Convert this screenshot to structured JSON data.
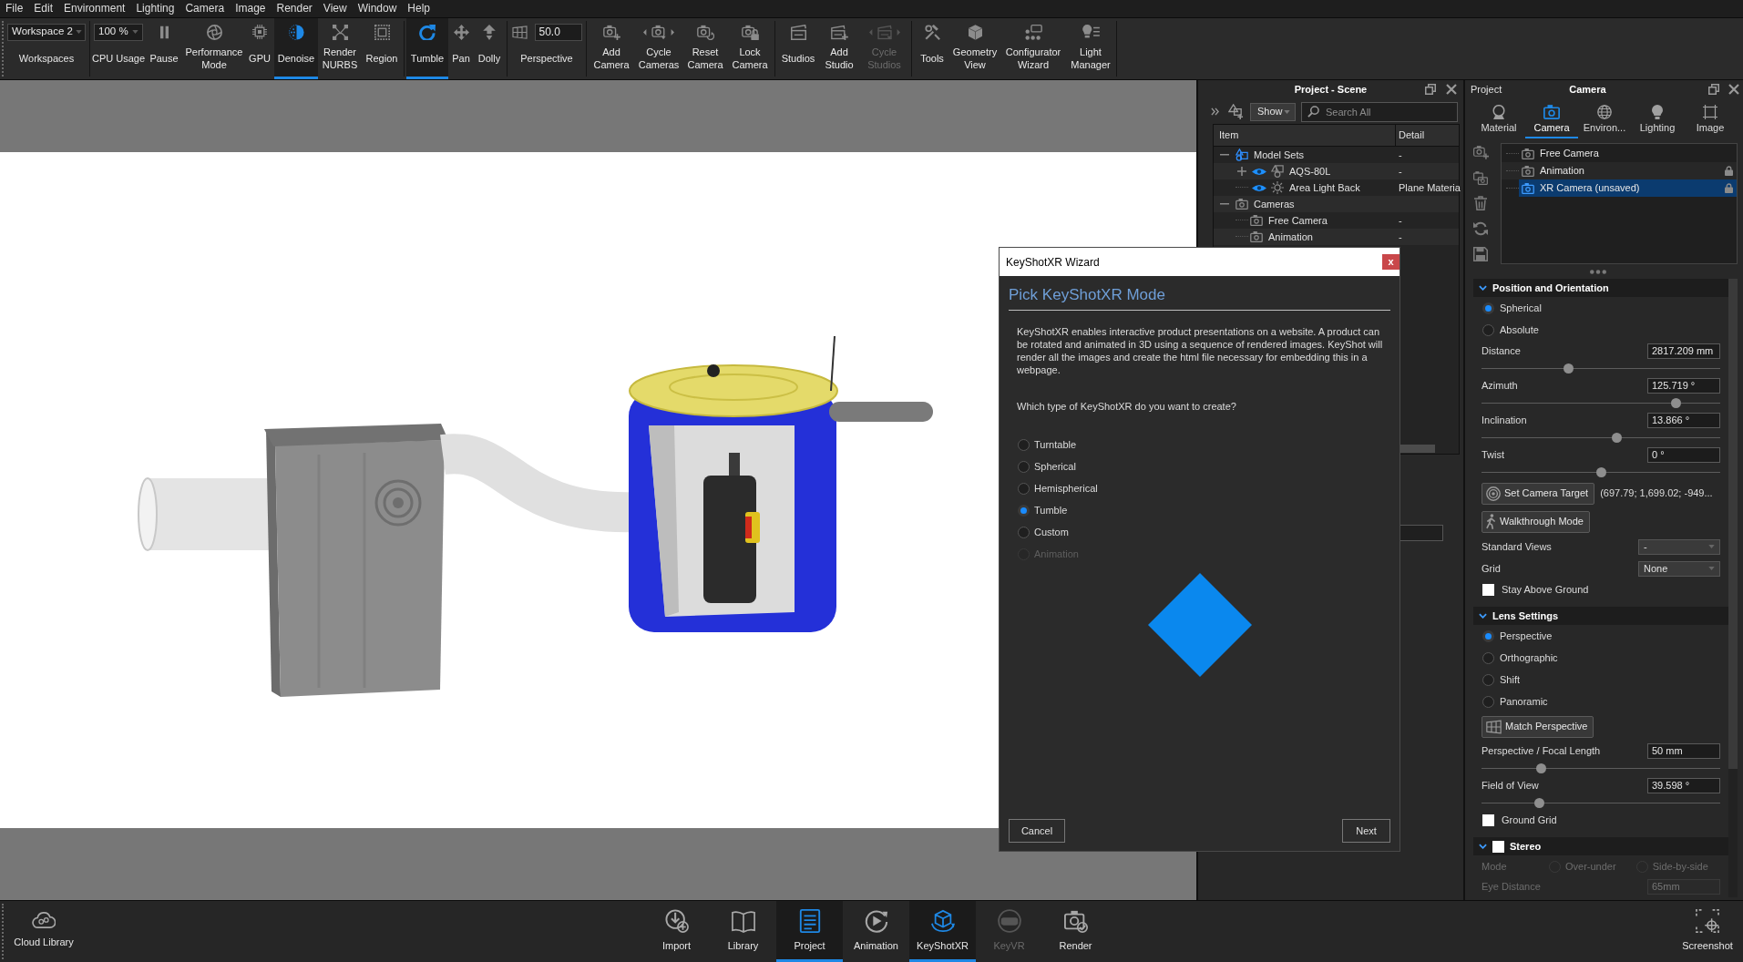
{
  "menu_bar": [
    "File",
    "Edit",
    "Environment",
    "Lighting",
    "Camera",
    "Image",
    "Render",
    "View",
    "Window",
    "Help"
  ],
  "toolbar": [
    {
      "items": [
        {
          "kind": "dropdown",
          "value": "Workspace 2",
          "label": "Workspaces"
        }
      ]
    },
    {
      "items": [
        {
          "kind": "dropdown",
          "value": "100 %",
          "label": "CPU Usage"
        },
        {
          "kind": "button",
          "label": "Pause",
          "selected": false,
          "disabled": false
        },
        {
          "kind": "button",
          "label": "Performance Mode",
          "selected": false,
          "disabled": false
        },
        {
          "kind": "button",
          "label": "GPU",
          "selected": false,
          "disabled": false
        },
        {
          "kind": "button",
          "label": "Denoise",
          "selected": true,
          "disabled": false
        },
        {
          "kind": "button",
          "label": "Render NURBS",
          "selected": false,
          "disabled": false
        },
        {
          "kind": "button",
          "label": "Region",
          "selected": false,
          "disabled": false
        }
      ]
    },
    {
      "items": [
        {
          "kind": "button",
          "label": "Tumble",
          "selected": true,
          "disabled": false
        },
        {
          "kind": "button",
          "label": "Pan",
          "selected": false,
          "disabled": false
        },
        {
          "kind": "button",
          "label": "Dolly",
          "selected": false,
          "disabled": false
        }
      ]
    },
    {
      "items": [
        {
          "kind": "number",
          "value": "50.0",
          "label": "Perspective"
        }
      ]
    },
    {
      "items": [
        {
          "kind": "button",
          "label": "Add Camera",
          "selected": false,
          "disabled": false
        },
        {
          "kind": "button",
          "label": "Cycle Cameras",
          "selected": false,
          "disabled": false
        },
        {
          "kind": "button",
          "label": "Reset Camera",
          "selected": false,
          "disabled": false
        },
        {
          "kind": "button",
          "label": "Lock Camera",
          "selected": false,
          "disabled": false
        }
      ]
    },
    {
      "items": [
        {
          "kind": "button",
          "label": "Studios",
          "selected": false,
          "disabled": false
        },
        {
          "kind": "button",
          "label": "Add Studio",
          "selected": false,
          "disabled": false
        },
        {
          "kind": "button",
          "label": "Cycle Studios",
          "selected": false,
          "disabled": true
        }
      ]
    },
    {
      "items": [
        {
          "kind": "button",
          "label": "Tools",
          "selected": false,
          "disabled": false
        },
        {
          "kind": "button",
          "label": "Geometry View",
          "selected": false,
          "disabled": false
        },
        {
          "kind": "button",
          "label": "Configurator Wizard",
          "selected": false,
          "disabled": false
        },
        {
          "kind": "button",
          "label": "Light Manager",
          "selected": false,
          "disabled": false
        }
      ]
    }
  ],
  "scene_panel": {
    "title": "Project - Scene",
    "show_button": "Show",
    "search": {
      "placeholder": "Search All"
    },
    "columns": [
      "Item",
      "Detail"
    ],
    "rows": [
      {
        "kind": "model_set",
        "label": "Model Sets",
        "detail": "-",
        "expanded": true,
        "children": [
          {
            "kind": "model",
            "label": "AQS-80L",
            "detail": "-",
            "expanded": false,
            "visible": true
          },
          {
            "kind": "light",
            "label": "Area Light Back",
            "detail": "Plane Materia",
            "visible": true
          }
        ]
      },
      {
        "kind": "camera_group",
        "label": "Cameras",
        "expanded": true,
        "children": [
          {
            "kind": "camera",
            "label": "Free Camera",
            "detail": "-"
          },
          {
            "kind": "camera",
            "label": "Animation",
            "detail": "-"
          }
        ]
      }
    ]
  },
  "camera_panel": {
    "project_label": "Project",
    "title": "Camera",
    "tabs": [
      {
        "label": "Material",
        "selected": false
      },
      {
        "label": "Camera",
        "selected": true
      },
      {
        "label": "Environ...",
        "selected": false
      },
      {
        "label": "Lighting",
        "selected": false
      },
      {
        "label": "Image",
        "selected": false
      }
    ],
    "cameras": [
      {
        "label": "Free Camera",
        "selected": false,
        "locked": false
      },
      {
        "label": "Animation",
        "selected": false,
        "locked": true
      },
      {
        "label": "XR Camera (unsaved)",
        "selected": true,
        "locked": true
      }
    ],
    "sections": [
      {
        "title": "Position and Orientation",
        "expanded": true,
        "rows": [
          {
            "kind": "radio",
            "label": "Spherical",
            "selected": true
          },
          {
            "kind": "radio",
            "label": "Absolute",
            "selected": false
          },
          {
            "kind": "slider",
            "label": "Distance",
            "value": "2817.209 mm",
            "level": 0.36
          },
          {
            "kind": "slider",
            "label": "Azimuth",
            "value": "125.719 °",
            "level": 0.83
          },
          {
            "kind": "slider",
            "label": "Inclination",
            "value": "13.866 °",
            "level": 0.57
          },
          {
            "kind": "slider",
            "label": "Twist",
            "value": "0 °",
            "level": 0.5
          },
          {
            "kind": "button",
            "label": "Set Camera Target",
            "value": "(697.79; 1,699.02; -949..."
          },
          {
            "kind": "button",
            "label": "Walkthrough Mode"
          },
          {
            "kind": "dropdown",
            "label": "Standard Views",
            "value": "-"
          },
          {
            "kind": "dropdown",
            "label": "Grid",
            "value": "None"
          },
          {
            "kind": "checkbox",
            "label": "Stay Above Ground",
            "checked": false
          }
        ]
      },
      {
        "title": "Lens Settings",
        "expanded": true,
        "rows": [
          {
            "kind": "radio",
            "label": "Perspective",
            "selected": true
          },
          {
            "kind": "radio",
            "label": "Orthographic",
            "selected": false
          },
          {
            "kind": "radio",
            "label": "Shift",
            "selected": false
          },
          {
            "kind": "radio",
            "label": "Panoramic",
            "selected": false
          },
          {
            "kind": "button",
            "label": "Match Perspective"
          },
          {
            "kind": "slider",
            "label": "Perspective / Focal Length",
            "value": "50 mm",
            "level": 0.24
          },
          {
            "kind": "slider",
            "label": "Field of View",
            "value": "39.598 °",
            "level": 0.23
          },
          {
            "kind": "checkbox",
            "label": "Ground Grid",
            "checked": false
          }
        ]
      },
      {
        "title": "Stereo",
        "expanded": true,
        "checked": false,
        "rows": [
          {
            "kind": "radio_group",
            "label": "Mode",
            "disabled": true,
            "options": [
              {
                "label": "Over-under",
                "selected": false
              },
              {
                "label": "Side-by-side",
                "selected": false
              }
            ]
          },
          {
            "kind": "field",
            "label": "Eye Distance",
            "value": "65mm",
            "disabled": true
          }
        ]
      }
    ]
  },
  "wizard": {
    "title": "KeyShotXR Wizard",
    "close_label": "x",
    "heading": "Pick KeyShotXR Mode",
    "description": "KeyShotXR enables interactive product presentations on a website. A product can be rotated and animated in 3D using a sequence of rendered images. KeyShot will render all the images and create the html file necessary for embedding this in a webpage.",
    "question": "Which type of KeyShotXR do you want to create?",
    "modes": [
      {
        "label": "Turntable",
        "selected": false,
        "disabled": false
      },
      {
        "label": "Spherical",
        "selected": false,
        "disabled": false
      },
      {
        "label": "Hemispherical",
        "selected": false,
        "disabled": false
      },
      {
        "label": "Tumble",
        "selected": true,
        "disabled": false
      },
      {
        "label": "Custom",
        "selected": false,
        "disabled": false
      },
      {
        "label": "Animation",
        "selected": false,
        "disabled": true
      }
    ],
    "buttons": [
      "Cancel",
      "Next"
    ]
  },
  "bottom_bar": {
    "cloud_button": {
      "label": "Cloud Library"
    },
    "tabs": [
      {
        "label": "Import",
        "selected": false,
        "disabled": false
      },
      {
        "label": "Library",
        "selected": false,
        "disabled": false
      },
      {
        "label": "Project",
        "selected": true,
        "disabled": false
      },
      {
        "label": "Animation",
        "selected": false,
        "disabled": false
      },
      {
        "label": "KeyShotXR",
        "selected": true,
        "disabled": false
      },
      {
        "label": "KeyVR",
        "selected": false,
        "disabled": true
      },
      {
        "label": "Render",
        "selected": false,
        "disabled": false
      }
    ],
    "screenshot_button": {
      "label": "Screenshot"
    }
  }
}
